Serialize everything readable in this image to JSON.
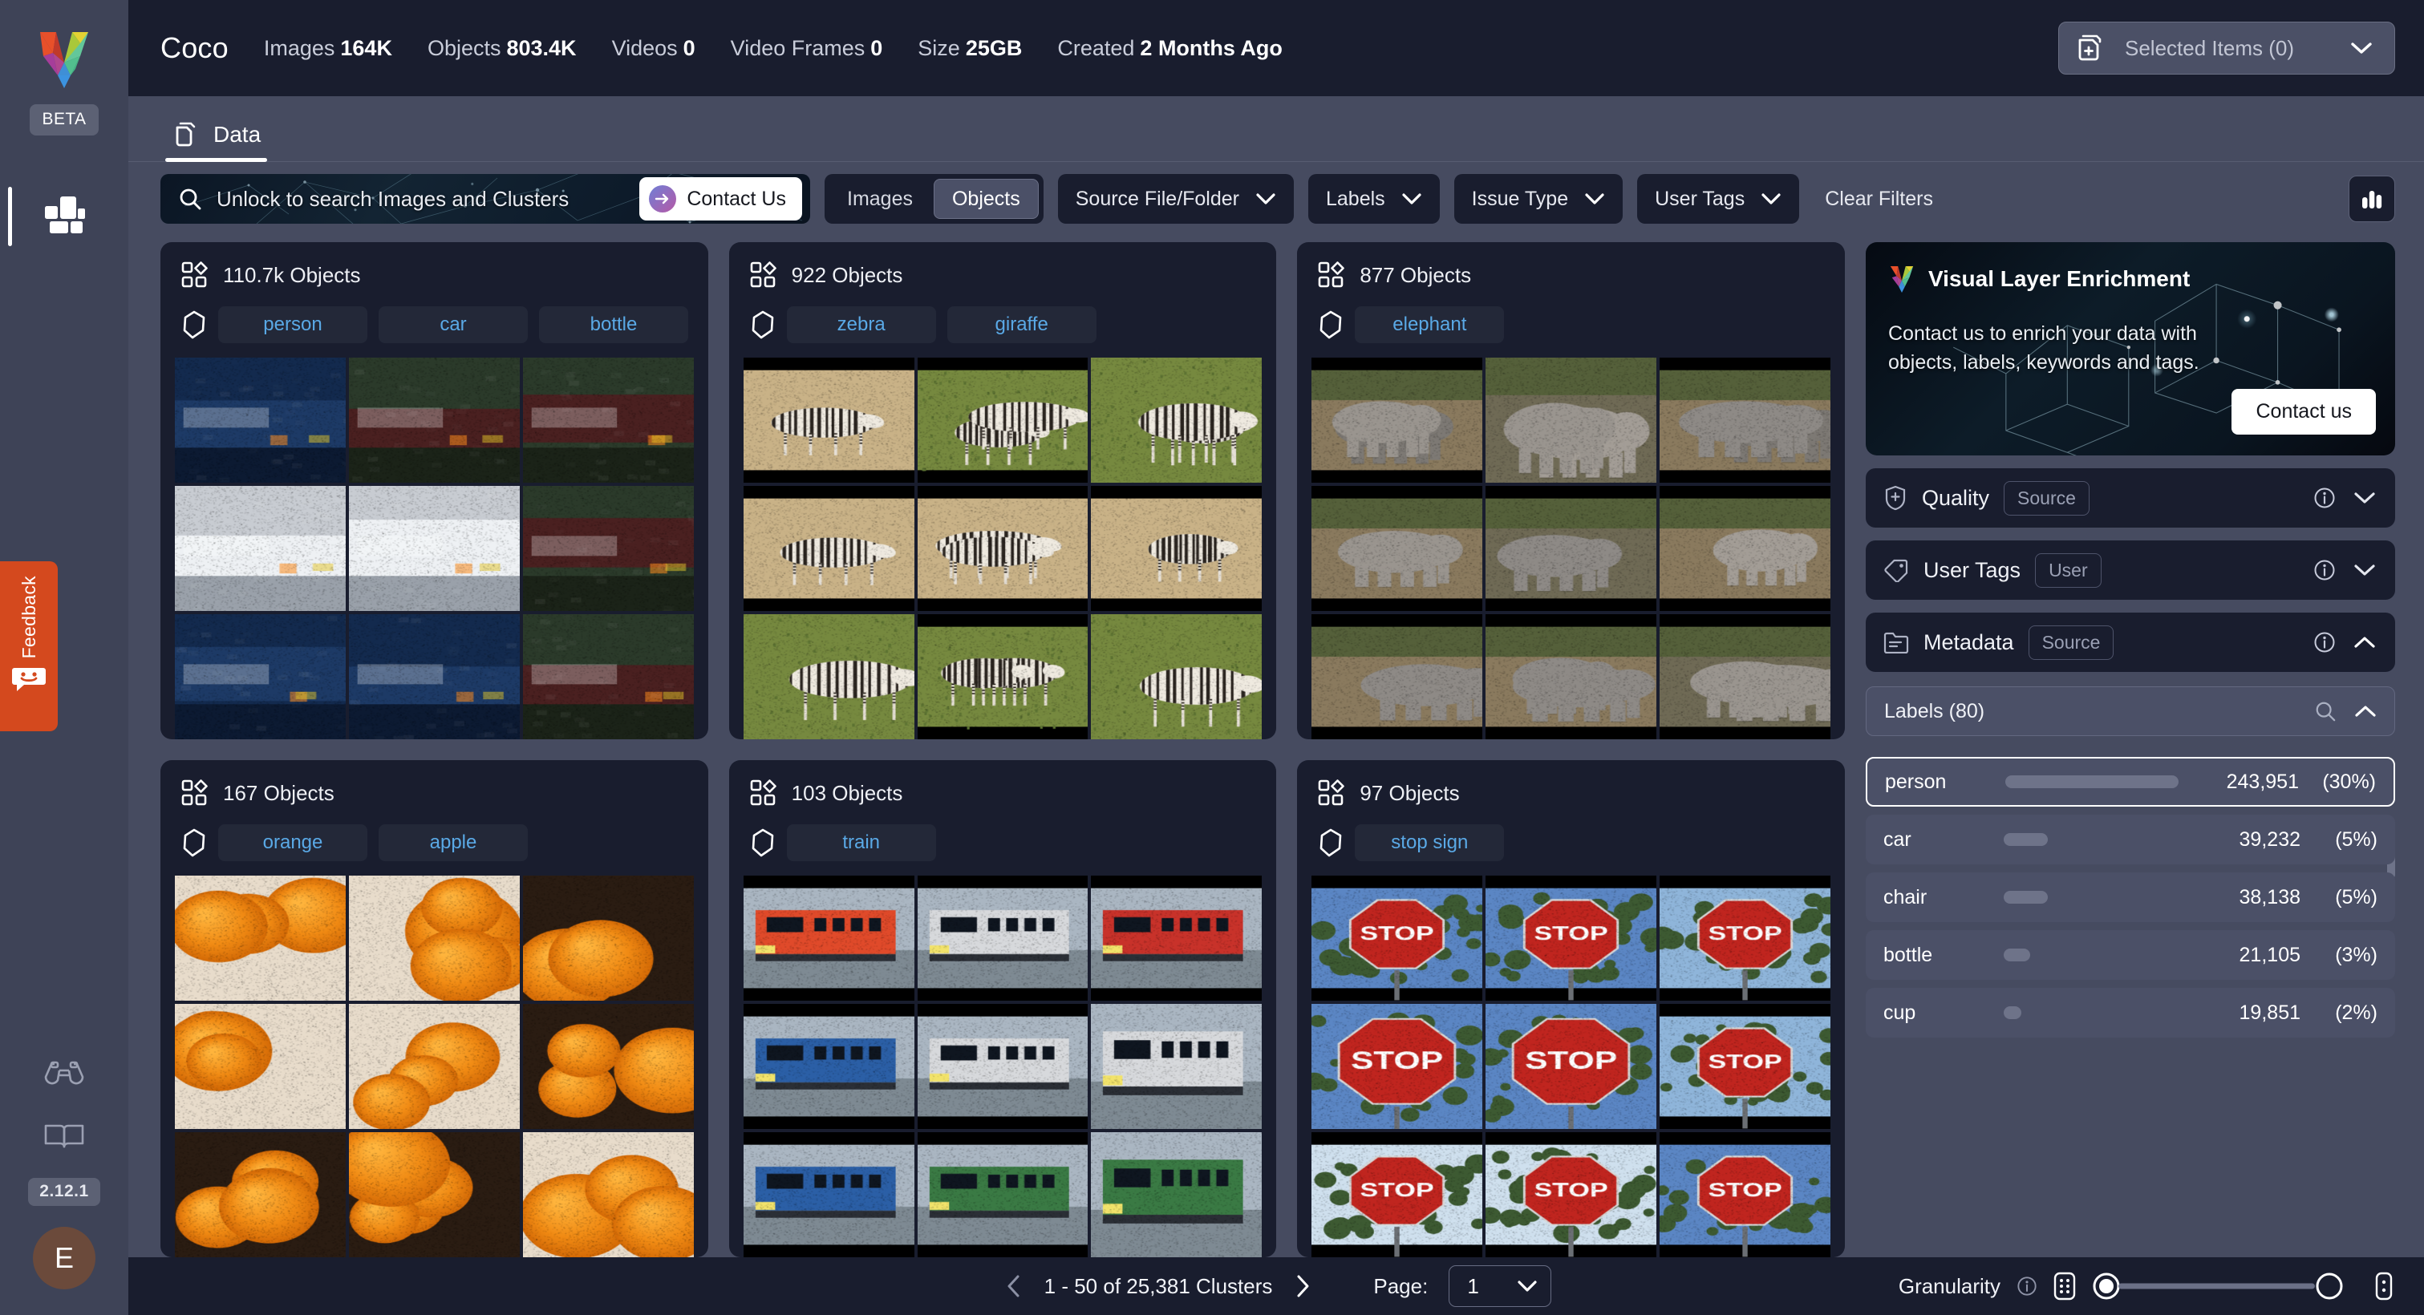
{
  "rail": {
    "logo_name": "visual-layer-logo",
    "beta_badge": "BETA",
    "version": "2.12.1",
    "avatar_initial": "E",
    "feedback_label": "Feedback",
    "accent_feedback": "#d4491e",
    "avatar_color": "#6b4a3b"
  },
  "topbar": {
    "dataset_title": "Coco",
    "stats": [
      {
        "label": "Images",
        "value": "164K"
      },
      {
        "label": "Objects",
        "value": "803.4K"
      },
      {
        "label": "Videos",
        "value": "0"
      },
      {
        "label": "Video Frames",
        "value": "0"
      },
      {
        "label": "Size",
        "value": "25GB"
      },
      {
        "label": "Created",
        "value": "2 Months Ago"
      }
    ],
    "selected_items_label": "Selected Items (0)"
  },
  "tabs": [
    {
      "label": "Data",
      "active": true
    }
  ],
  "filterbar": {
    "search_placeholder": "Unlock to search Images and Clusters",
    "contact_pill": "Contact Us",
    "segments": [
      {
        "label": "Images",
        "active": false
      },
      {
        "label": "Objects",
        "active": true
      }
    ],
    "dropdowns": [
      {
        "label": "Source File/Folder"
      },
      {
        "label": "Labels"
      },
      {
        "label": "Issue Type"
      },
      {
        "label": "User Tags"
      }
    ],
    "clear_filters": "Clear Filters"
  },
  "clusters": [
    {
      "count": "110.7k Objects",
      "labels": [
        "person",
        "car",
        "bottle"
      ],
      "theme": "vehicles"
    },
    {
      "count": "922 Objects",
      "labels": [
        "zebra",
        "giraffe"
      ],
      "theme": "zebra"
    },
    {
      "count": "877 Objects",
      "labels": [
        "elephant"
      ],
      "theme": "elephant"
    },
    {
      "count": "167 Objects",
      "labels": [
        "orange",
        "apple"
      ],
      "theme": "orange"
    },
    {
      "count": "103 Objects",
      "labels": [
        "train"
      ],
      "theme": "train"
    },
    {
      "count": "97 Objects",
      "labels": [
        "stop sign"
      ],
      "theme": "stopsign"
    }
  ],
  "promo": {
    "title": "Visual Layer Enrichment",
    "text": "Contact us to enrich your data with objects, labels, keywords and tags.",
    "button": "Contact us"
  },
  "facets": [
    {
      "name": "Quality",
      "source": "Source",
      "expanded": false
    },
    {
      "name": "User Tags",
      "source": "User",
      "expanded": false
    },
    {
      "name": "Metadata",
      "source": "Source",
      "expanded": true
    }
  ],
  "labels_panel": {
    "header": "Labels (80)",
    "rows": [
      {
        "name": "person",
        "count": "243,951",
        "pct": "(30%)",
        "bar": 30,
        "selected": true
      },
      {
        "name": "car",
        "count": "39,232",
        "pct": "(5%)",
        "bar": 5,
        "selected": false
      },
      {
        "name": "chair",
        "count": "38,138",
        "pct": "(5%)",
        "bar": 5,
        "selected": false
      },
      {
        "name": "bottle",
        "count": "21,105",
        "pct": "(3%)",
        "bar": 3,
        "selected": false
      },
      {
        "name": "cup",
        "count": "19,851",
        "pct": "(2%)",
        "bar": 2,
        "selected": false
      }
    ]
  },
  "bottombar": {
    "range": "1 - 50 of 25,381 Clusters",
    "page_label": "Page:",
    "page_value": "1",
    "granularity_label": "Granularity",
    "granularity_value": 0
  }
}
